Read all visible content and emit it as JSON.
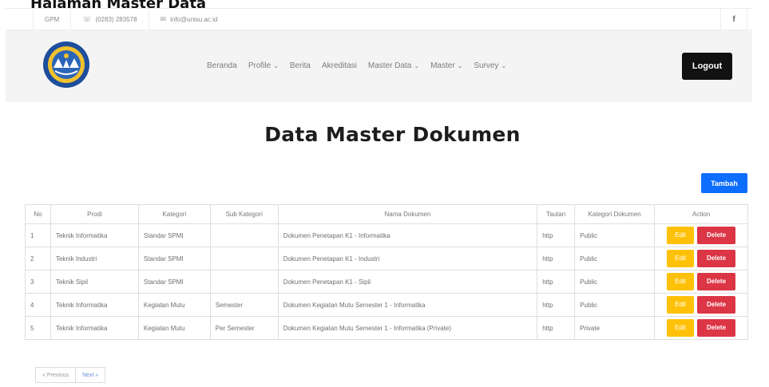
{
  "doc_caption": "Halaman Master Data",
  "topbar": {
    "org": "GPM",
    "phone": "(0283) 283578",
    "email": "info@unisu.ac.id",
    "social_fb": "f"
  },
  "nav": {
    "items": [
      {
        "label": "Beranda",
        "dropdown": false
      },
      {
        "label": "Profile",
        "dropdown": true
      },
      {
        "label": "Berita",
        "dropdown": false
      },
      {
        "label": "Akreditasi",
        "dropdown": false
      },
      {
        "label": "Master Data",
        "dropdown": true
      },
      {
        "label": "Master",
        "dropdown": true
      },
      {
        "label": "Survey",
        "dropdown": true
      }
    ],
    "logout_label": "Logout"
  },
  "page": {
    "title": "Data Master Dokumen",
    "add_label": "Tambah"
  },
  "table": {
    "headers": [
      "No",
      "Prodi",
      "Kategori",
      "Sub Kategori",
      "Nama Dokumen",
      "Tautan",
      "Kategori Dokumen",
      "Action"
    ],
    "rows": [
      {
        "no": "1",
        "prodi": "Teknik Informatika",
        "kategori": "Standar SPMI",
        "sub_kategori": "",
        "nama": "Dokumen Penetapan K1 - Informatika",
        "tautan": "http",
        "kategori_dokumen": "Public"
      },
      {
        "no": "2",
        "prodi": "Teknik Industri",
        "kategori": "Standar SPMI",
        "sub_kategori": "",
        "nama": "Dokumen Penetapan K1 - Industri",
        "tautan": "http",
        "kategori_dokumen": "Public"
      },
      {
        "no": "3",
        "prodi": "Teknik Sipil",
        "kategori": "Standar SPMI",
        "sub_kategori": "",
        "nama": "Dokumen Penetapan K1 - Sipil",
        "tautan": "http",
        "kategori_dokumen": "Public"
      },
      {
        "no": "4",
        "prodi": "Teknik Informatika",
        "kategori": "Kegiatan Mutu",
        "sub_kategori": "Semester",
        "nama": "Dokumen Kegiatan Mutu Semester 1 - Informatika",
        "tautan": "http",
        "kategori_dokumen": "Public"
      },
      {
        "no": "5",
        "prodi": "Teknik Informatika",
        "kategori": "Kegiatan Mutu",
        "sub_kategori": "Per Semester",
        "nama": "Dokumen Kegiatan Mutu Semester 1 - Informatika (Private)",
        "tautan": "http",
        "kategori_dokumen": "Private"
      }
    ],
    "edit_label": "Edit",
    "delete_label": "Delete"
  },
  "pagination": {
    "prev_label": "« Previous",
    "next_label": "Next »"
  },
  "colors": {
    "primary": "#0d6efd",
    "warning": "#ffc107",
    "danger": "#dc3545",
    "dark": "#111111",
    "navbar_bg": "#f4f4f4"
  },
  "icons": {
    "phone": "phone-icon",
    "email": "email-icon",
    "facebook": "facebook-icon",
    "caret": "chevron-down-icon",
    "logo": "university-logo"
  }
}
